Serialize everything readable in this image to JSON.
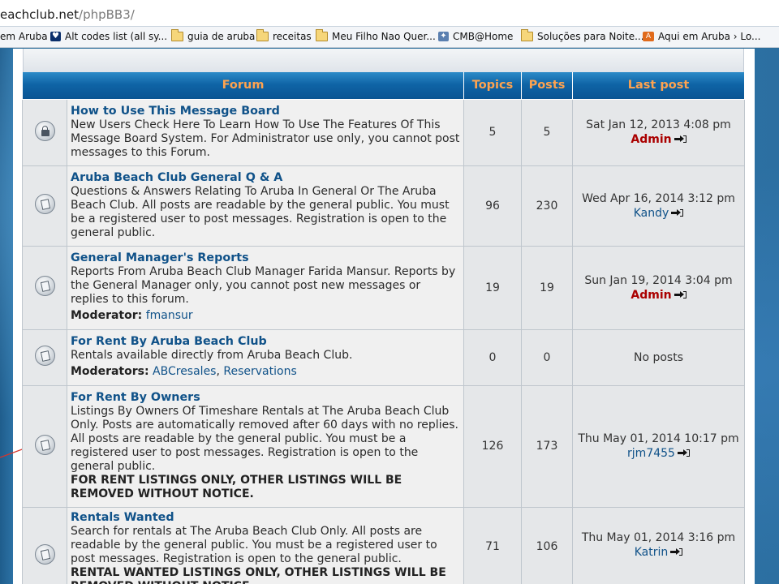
{
  "browser": {
    "url_host": "eachclub.net",
    "url_path": "/phpBB3/",
    "bookmarks": [
      {
        "label": "em Aruba",
        "icon": "none"
      },
      {
        "label": "Alt codes list (all sy...",
        "icon": "heart-icon"
      },
      {
        "label": "guia de aruba",
        "icon": "folder-icon"
      },
      {
        "label": "receitas",
        "icon": "folder-icon"
      },
      {
        "label": "Meu Filho Nao Quer...",
        "icon": "folder-icon"
      },
      {
        "label": "CMB@Home",
        "icon": "cmb-icon"
      },
      {
        "label": "Soluções para Noite...",
        "icon": "folder-icon"
      },
      {
        "label": "Aqui em Aruba › Lo...",
        "icon": "aqui-icon"
      }
    ]
  },
  "colors": {
    "header_text": "#ffa34f",
    "forum_link": "#105289",
    "admin": "#aa0000"
  },
  "table": {
    "headers": {
      "forum": "Forum",
      "topics": "Topics",
      "posts": "Posts",
      "last_post": "Last post"
    },
    "rows": [
      {
        "icon": "locked-forum-icon",
        "title": "How to Use This Message Board",
        "description": "New Users Check Here To Learn How To Use The Features Of This Message Board System. For Administrator use only, you cannot post messages to this Forum.",
        "topics": "5",
        "posts": "5",
        "last_date": "Sat Jan 12, 2013 4:08 pm",
        "last_author": "Admin"
      },
      {
        "icon": "forum-read-icon",
        "title": "Aruba Beach Club General Q & A",
        "description": "Questions & Answers Relating To Aruba In General Or The Aruba Beach Club. All posts are readable by the general public. You must be a registered user to post messages. Registration is open to the general public.",
        "topics": "96",
        "posts": "230",
        "last_date": "Wed Apr 16, 2014 3:12 pm",
        "last_author": "Kandy"
      },
      {
        "icon": "forum-read-icon",
        "title": "General Manager's Reports",
        "description": "Reports From Aruba Beach Club Manager Farida Mansur. Reports by the General Manager only, you cannot post new messages or replies to this forum.",
        "moderator_label": "Moderator:",
        "moderators": [
          "fmansur"
        ],
        "topics": "19",
        "posts": "19",
        "last_date": "Sun Jan 19, 2014 3:04 pm",
        "last_author": "Admin"
      },
      {
        "icon": "forum-read-icon",
        "title": "For Rent By Aruba Beach Club",
        "description": "Rentals available directly from Aruba Beach Club.",
        "moderator_label": "Moderators:",
        "moderators": [
          "ABCresales",
          "Reservations"
        ],
        "topics": "0",
        "posts": "0",
        "last_text": "No posts"
      },
      {
        "icon": "forum-read-icon",
        "title": "For Rent By Owners",
        "description": "Listings By Owners Of Timeshare Rentals at The Aruba Beach Club Only. Posts are automatically removed after 60 days with no replies. All posts are readable by the general public. You must be a registered user to post messages. Registration is open to the general public.",
        "notice": "FOR RENT LISTINGS ONLY, OTHER LISTINGS WILL BE REMOVED WITHOUT NOTICE.",
        "topics": "126",
        "posts": "173",
        "last_date": "Thu May 01, 2014 10:17 pm",
        "last_author": "rjm7455"
      },
      {
        "icon": "forum-read-icon",
        "title": "Rentals Wanted",
        "description": "Search for rentals at The Aruba Beach Club Only. All posts are readable by the general public. You must be a registered user to post messages. Registration is open to the general public.",
        "notice": "RENTAL WANTED LISTINGS ONLY, OTHER LISTINGS WILL BE REMOVED WITHOUT NOTICE.",
        "topics": "71",
        "posts": "106",
        "last_date": "Thu May 01, 2014 3:16 pm",
        "last_author": "Katrin"
      }
    ]
  }
}
